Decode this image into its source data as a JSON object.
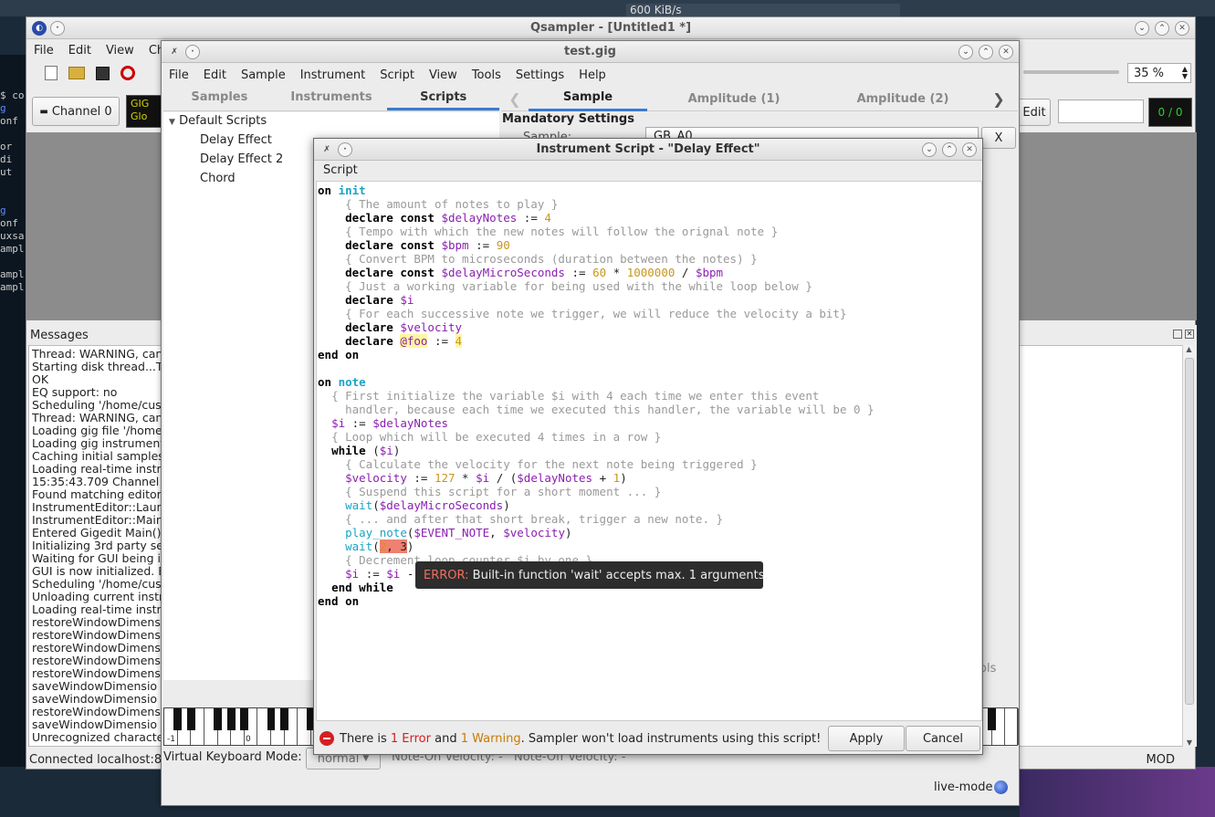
{
  "desktop": {
    "network_speed": "600 KiB/s"
  },
  "qsampler": {
    "title": "Qsampler - [Untitled1 *]",
    "menu": [
      "File",
      "Edit",
      "View",
      "Cha"
    ],
    "channel_button": "Channel 0",
    "gig_label": "GIG",
    "gig_sub": "Glo",
    "zoom": "35 %",
    "edit_button": "Edit",
    "counter": "0 / 0",
    "messages_title": "Messages",
    "messages": [
      "Thread: WARNING, can",
      "Starting disk thread...T",
      "OK",
      "EQ support: no",
      "Scheduling '/home/cus",
      "Thread: WARNING, can",
      "Loading gig file '/home",
      "Loading gig instrument",
      "Caching initial samples",
      "Loading real-time instr",
      "15:35:43.709 Channel",
      "Found matching editor",
      "InstrumentEditor::Laun",
      "InstrumentEditor::Main",
      "Entered Gigedit Main()",
      "Initializing 3rd party se",
      "Waiting for GUI being in",
      "GUI is now initialized. E",
      "Scheduling '/home/cus",
      "Unloading current instr",
      "Loading real-time instr",
      "restoreWindowDimensi",
      "restoreWindowDimensi",
      "restoreWindowDimensi",
      "restoreWindowDimensi",
      "restoreWindowDimensi",
      "saveWindowDimensio",
      "saveWindowDimensio",
      "restoreWindowDimensi",
      "saveWindowDimensio",
      "Unrecognized characte"
    ],
    "status_connected": "Connected localhost:8",
    "status_mod": "MOD"
  },
  "terminal": {
    "lines": [
      "$ co",
      "g",
      "onf",
      "",
      "or di",
      "",
      "ut",
      "",
      "",
      "g",
      "onf",
      "uxsa",
      "ampl",
      "",
      "ampl",
      "ampl"
    ]
  },
  "gigedit": {
    "title": "test.gig",
    "menu": [
      "File",
      "Edit",
      "Sample",
      "Instrument",
      "Script",
      "View",
      "Tools",
      "Settings",
      "Help"
    ],
    "left_tabs": [
      "Samples",
      "Instruments",
      "Scripts"
    ],
    "right_tabs": [
      "Sample",
      "Amplitude (1)",
      "Amplitude (2)"
    ],
    "tree_root": "Default Scripts",
    "scripts": [
      "Delay Effect",
      "Delay Effect 2",
      "Chord"
    ],
    "mandatory_settings": "Mandatory Settings",
    "sample_label": "Sample:",
    "sample_value": "GB_A0",
    "x_button": "X",
    "vk_mode_label": "Virtual Keyboard Mode:",
    "vk_mode_value": "normal",
    "note_on_velocity": "Note-On Velocity:  -",
    "note_off_velocity": "Note-Off Velocity:  -",
    "live_mode": "live-mode",
    "key_labels": [
      "-1",
      "0"
    ],
    "partial_label": "ols"
  },
  "script_editor": {
    "title": "Instrument Script - \"Delay Effect\"",
    "menu": "Script",
    "tooltip_error": "ERROR:",
    "tooltip_text": " Built-in function 'wait' accepts max. 1 arguments.",
    "status_pre": "There is ",
    "status_errors": "1 Error",
    "status_mid": " and ",
    "status_warnings": "1 Warning",
    "status_post": ". Sampler won't load instruments using this script!",
    "apply": "Apply",
    "cancel": "Cancel"
  }
}
